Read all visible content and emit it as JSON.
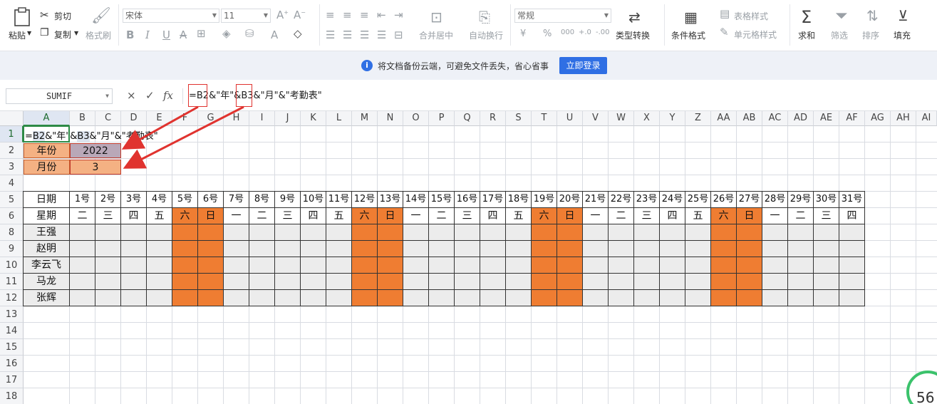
{
  "ribbon": {
    "paste": "粘贴",
    "cut": "剪切",
    "copy": "复制",
    "format_painter": "格式刷",
    "font_name": "宋体",
    "font_size": "11",
    "merge_center": "合并居中",
    "wrap_text": "自动换行",
    "number_format": "常规",
    "type_convert": "类型转换",
    "conditional_format": "条件格式",
    "table_style": "表格样式",
    "cell_style": "单元格样式",
    "sum": "求和",
    "filter": "筛选",
    "sort": "排序",
    "fill": "填充",
    "currency": "¥",
    "percent": "%",
    "thousands": "000",
    "inc_decimal": "+.0",
    "dec_decimal": "-.00"
  },
  "notice": {
    "message": "将文档备份云端，可避免文件丢失，省心省事",
    "login_button": "立即登录"
  },
  "formula_bar": {
    "name_box": "SUMIF",
    "cancel": "×",
    "confirm": "✓",
    "fx": "fx",
    "formula": "=B2&\"年\"&B3&\"月\"&\"考勤表\""
  },
  "sheet": {
    "col_headers": [
      "A",
      "B",
      "C",
      "D",
      "E",
      "F",
      "G",
      "H",
      "I",
      "J",
      "K",
      "L",
      "M",
      "N",
      "O",
      "P",
      "Q",
      "R",
      "S",
      "T",
      "U",
      "V",
      "W",
      "X",
      "Y",
      "Z",
      "AA",
      "AB",
      "AC",
      "AD",
      "AE",
      "AF",
      "AG",
      "AH",
      "AI"
    ],
    "row_headers": [
      "1",
      "2",
      "3",
      "4",
      "5",
      "6",
      "8",
      "9",
      "10",
      "11",
      "12",
      "13",
      "14",
      "15",
      "16",
      "17",
      "18"
    ],
    "a1_parts": [
      "=",
      "B2",
      "&\"年\"&",
      "B3",
      "&\"月\"&\"考勤表\""
    ],
    "year_label": "年份",
    "year_value": "2022",
    "month_label": "月份",
    "month_value": "3",
    "date_label": "日期",
    "weekday_label": "星期",
    "days": [
      "1号",
      "2号",
      "3号",
      "4号",
      "5号",
      "6号",
      "7号",
      "8号",
      "9号",
      "10号",
      "11号",
      "12号",
      "13号",
      "14号",
      "15号",
      "16号",
      "17号",
      "18号",
      "19号",
      "20号",
      "21号",
      "22号",
      "23号",
      "24号",
      "25号",
      "26号",
      "27号",
      "28号",
      "29号",
      "30号",
      "31号"
    ],
    "weekdays": [
      "二",
      "三",
      "四",
      "五",
      "六",
      "日",
      "一",
      "二",
      "三",
      "四",
      "五",
      "六",
      "日",
      "一",
      "二",
      "三",
      "四",
      "五",
      "六",
      "日",
      "一",
      "二",
      "三",
      "四",
      "五",
      "六",
      "日",
      "一",
      "二",
      "三",
      "四"
    ],
    "names": [
      "王强",
      "赵明",
      "李云飞",
      "马龙",
      "张辉"
    ]
  },
  "colors": {
    "weekend_fill": "#ef7d32",
    "label_fill": "#f4b183",
    "year_fill": "#b9a8b8",
    "selection_green": "#2d8a46",
    "arrow_red": "#e0332f",
    "accent_blue": "#2f6fe4"
  },
  "status_badge": "56"
}
